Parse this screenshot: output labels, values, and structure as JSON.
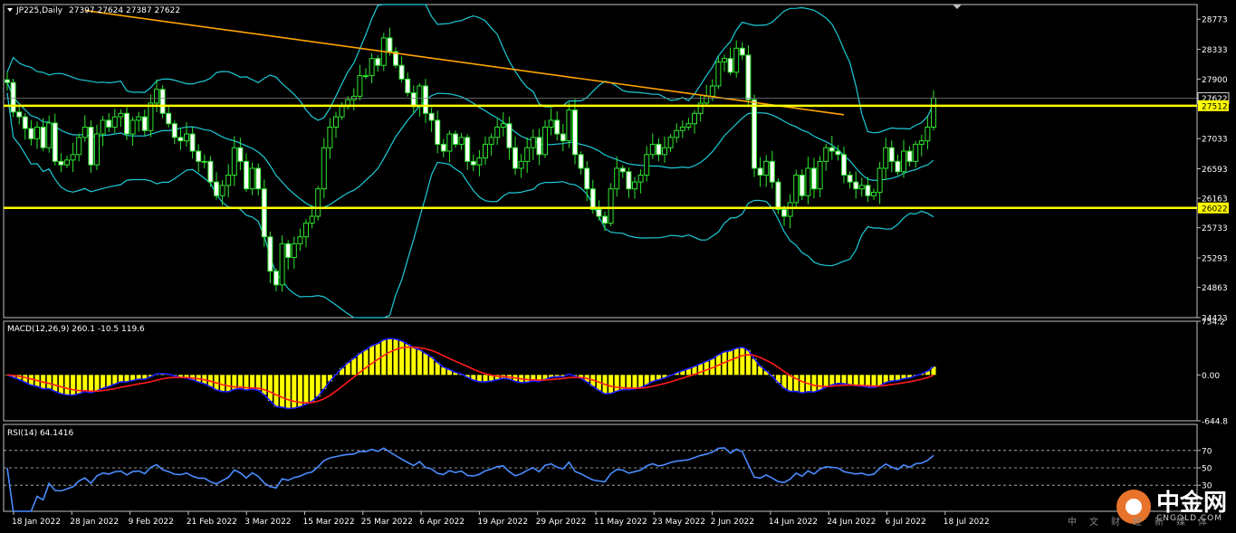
{
  "chart_data": [
    {
      "panel": "price",
      "type": "candlestick",
      "title": "JP225,Daily",
      "ohlc_readout": "27397 27624 27387 27622",
      "current_price_label": "27622",
      "ylim": [
        24423,
        28987
      ],
      "y_ticks": [
        "28773",
        "28333",
        "27900",
        "27622",
        "27512",
        "27033",
        "26593",
        "26163",
        "26022",
        "25733",
        "25293",
        "24863",
        "24423"
      ],
      "x_labels": [
        "18 Jan 2022",
        "28 Jan 2022",
        "9 Feb 2022",
        "21 Feb 2022",
        "3 Mar 2022",
        "15 Mar 2022",
        "25 Mar 2022",
        "6 Apr 2022",
        "19 Apr 2022",
        "29 Apr 2022",
        "11 May 2022",
        "23 May 2022",
        "2 Jun 2022",
        "14 Jun 2022",
        "24 Jun 2022",
        "6 Jul 2022",
        "18 Jul 2022"
      ],
      "horizontal_levels": [
        {
          "label": "27512",
          "value": 27512,
          "color": "#ffff00"
        },
        {
          "label": "26022",
          "value": 26022,
          "color": "#ffff00"
        }
      ],
      "trendline": {
        "color": "#ffa500",
        "from": {
          "x": 13,
          "y": 28900
        },
        "to": {
          "x": 140,
          "y": 27380
        }
      },
      "closes": [
        27850,
        27420,
        27350,
        27180,
        27030,
        27200,
        26900,
        27260,
        26700,
        26650,
        26720,
        26800,
        27050,
        27200,
        26650,
        27100,
        27300,
        27200,
        27350,
        27400,
        27100,
        27300,
        27350,
        27150,
        27550,
        27750,
        27400,
        27250,
        27050,
        27000,
        27100,
        26850,
        26700,
        26700,
        26400,
        26200,
        26350,
        26500,
        26900,
        26700,
        26300,
        26600,
        26300,
        25600,
        25100,
        24900,
        25500,
        25300,
        25500,
        25600,
        25800,
        25900,
        26300,
        26900,
        27200,
        27350,
        27500,
        27600,
        27650,
        27950,
        27950,
        28200,
        28100,
        28500,
        28300,
        28100,
        27900,
        27700,
        27500,
        27800,
        27400,
        27300,
        26950,
        26850,
        27100,
        26950,
        27050,
        26700,
        26650,
        26750,
        26950,
        27050,
        27200,
        27250,
        26900,
        26600,
        26700,
        26900,
        27050,
        26800,
        27200,
        27300,
        27100,
        27000,
        27450,
        26800,
        26600,
        26300,
        26000,
        25900,
        25800,
        26300,
        26600,
        26550,
        26300,
        26400,
        26500,
        26800,
        26950,
        26800,
        26900,
        27050,
        27150,
        27200,
        27250,
        27400,
        27550,
        27650,
        27800,
        28150,
        28200,
        28000,
        28350,
        28250,
        27600,
        26600,
        26500,
        26700,
        26400,
        26000,
        25900,
        26100,
        26500,
        26200,
        26600,
        26300,
        26700,
        26900,
        26850,
        26800,
        26500,
        26400,
        26300,
        26350,
        26200,
        26250,
        26600,
        26900,
        26700,
        26550,
        26850,
        26700,
        26950,
        27000,
        27200,
        27622
      ],
      "bollinger": {
        "color": "#1ecbd8"
      },
      "candle_color": "#2ee62e"
    },
    {
      "panel": "macd",
      "type": "bar+line",
      "title": "MACD(12,26,9) 260.1 -10.5 119.6",
      "ylim": [
        -644.8,
        754.2
      ],
      "y_ticks": [
        "754.2",
        "0.00",
        "-644.8"
      ],
      "histogram_color": "#ffff00",
      "main_color": "#1a1aff",
      "signal_color": "#ff1a1a"
    },
    {
      "panel": "rsi",
      "type": "line",
      "title": "RSI(14) 64.1416",
      "ylim": [
        0,
        100
      ],
      "y_ticks": [
        "70",
        "50",
        "30"
      ],
      "levels": [
        70,
        50,
        30
      ],
      "line_color": "#4a8cff"
    }
  ],
  "watermark": {
    "title": "中金网",
    "site": "CNGOLD.COM",
    "slogan": "中文财经新媒体"
  }
}
